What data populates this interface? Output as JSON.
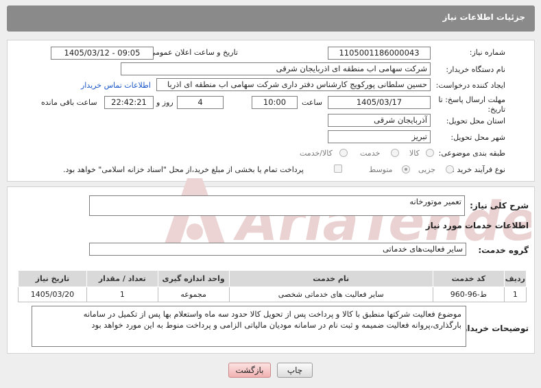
{
  "header": {
    "title": "جزئیات اطلاعات نیاز"
  },
  "form": {
    "need_number_label": "شماره نیاز:",
    "need_number": "1105001186000043",
    "announce_label": "تاریخ و ساعت اعلان عمومی:",
    "announce_value": "1405/03/12 - 09:05",
    "buyer_label": "نام دستگاه خریدار:",
    "buyer_value": "شرکت سهامی اب منطقه ای اذربایجان شرقی",
    "creator_label": "ایجاد کننده درخواست:",
    "creator_value": "حسین سلطانی پورکویج کارشناس دفتر داری شرکت سهامی اب منطقه ای اذربا",
    "contact_link": "اطلاعات تماس خریدار",
    "deadline_label": "مهلت ارسال پاسخ: تا تاریخ:",
    "deadline_date": "1405/03/17",
    "time_label": "ساعت",
    "deadline_time": "10:00",
    "days_value": "4",
    "days_label": "روز و",
    "remaining_time": "22:42:21",
    "remaining_label": "ساعت باقی مانده",
    "province_label": "استان محل تحویل:",
    "province_value": "آذربایجان شرقی",
    "city_label": "شهر محل تحویل:",
    "city_value": "تبریز",
    "category_label": "طبقه بندی موضوعی:",
    "category_options": [
      "کالا",
      "خدمت",
      "کالا/خدمت"
    ],
    "process_label": "نوع فرآیند خرید :",
    "process_options": [
      "جزیی",
      "متوسط"
    ],
    "payment_note": "پرداخت تمام یا بخشی از مبلغ خرید،از محل \"اسناد خزانه اسلامی\" خواهد بود."
  },
  "description": {
    "label": "شرح کلی نیاز:",
    "value": "تعمیر موتورخانه"
  },
  "services": {
    "section_title": "اطلاعات خدمات مورد نیاز",
    "group_label": "گروه خدمت:",
    "group_value": "سایر فعالیت‌های خدماتی",
    "columns": [
      "ردیف",
      "کد خدمت",
      "نام خدمت",
      "واحد اندازه گیری",
      "تعداد / مقدار",
      "تاریخ نیاز"
    ],
    "rows": [
      {
        "index": "1",
        "code": "ط-96-960",
        "name": "سایر فعالیت های خدماتی شخصی",
        "unit": "مجموعه",
        "qty": "1",
        "date": "1405/03/20"
      }
    ]
  },
  "buyer_notes": {
    "label": "توضیحات خریدار:",
    "value": "موضوع فعالیت شرکتها منطبق با کالا و پرداخت پس از تحویل کالا حدود سه  ماه واستعلام بها پس از تکمیل در سامانه بارگذاری،پروانه فعالیت ضمیمه و ثبت نام در سامانه مودیان مالیاتی الزامی و پرداخت منوط به این مورد خواهد بود"
  },
  "buttons": {
    "print": "چاپ",
    "back": "بازگشت"
  },
  "colors": {
    "header_bg": "#8a8a8a",
    "link": "#1a56c8",
    "watermark": "#e6c9c9"
  }
}
